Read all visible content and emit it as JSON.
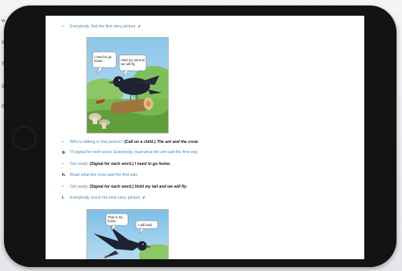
{
  "background": {
    "fragments": [
      "w",
      "0.",
      "S",
      "0.",
      "0."
    ]
  },
  "lines": [
    {
      "marker": "•",
      "parts": [
        {
          "t": "Everybody, find the first story picture. ",
          "s": "n"
        },
        {
          "t": "✓",
          "s": "ck"
        }
      ]
    },
    {
      "marker": "•",
      "parts": [
        {
          "t": "Who is talking in that picture? ",
          "s": "n"
        },
        {
          "t": "(Call on a child.) ",
          "s": "b"
        },
        {
          "t": "The ant and the crow.",
          "s": "bi"
        }
      ]
    },
    {
      "marker": "g.",
      "parts": [
        {
          "t": "I'll signal for each word. Everybody, read what the ant said the first way.",
          "s": "n"
        }
      ]
    },
    {
      "marker": "•",
      "parts": [
        {
          "t": "Get ready. ",
          "s": "n"
        },
        {
          "t": "(Signal for each word.) ",
          "s": "b"
        },
        {
          "t": "I need to go home.",
          "s": "bi"
        }
      ]
    },
    {
      "marker": "h.",
      "parts": [
        {
          "t": "Read what the crow said the first way.",
          "s": "n"
        }
      ]
    },
    {
      "marker": "•",
      "parts": [
        {
          "t": "Get ready. ",
          "s": "n"
        },
        {
          "t": "(Signal for each word.) ",
          "s": "b"
        },
        {
          "t": "Hold my tail and we will fly.",
          "s": "bi"
        }
      ]
    },
    {
      "marker": "i.",
      "parts": [
        {
          "t": "Everybody, touch the next story picture. ",
          "s": "n"
        },
        {
          "t": "✓",
          "s": "ck"
        }
      ]
    }
  ],
  "picture1": {
    "ant_bubble": "I need to go home.",
    "crow_bubble": "Hold my tail and we will fly."
  },
  "picture2": {
    "left_bubble": "That is my home.",
    "right_bubble": "I will land."
  },
  "colors": {
    "instruction_blue": "#4b8bb8",
    "bold_text": "#1a1a1a",
    "tablet_bezel": "#141213"
  }
}
